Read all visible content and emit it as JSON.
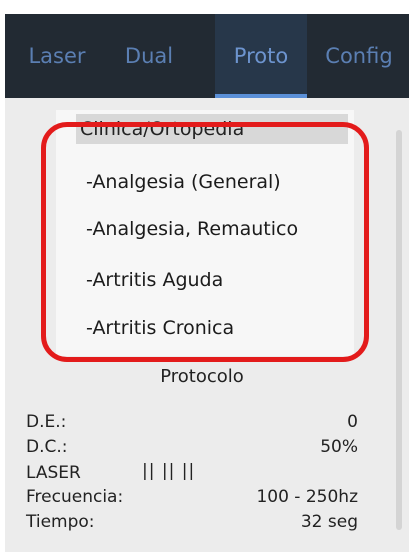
{
  "tabs": [
    {
      "label": "Laser",
      "active": false
    },
    {
      "label": "Dual",
      "active": false
    },
    {
      "label": "Proto",
      "active": true
    },
    {
      "label": "Config",
      "active": false
    }
  ],
  "protocol_list": {
    "header": "Clinica/Ortopedia",
    "items": [
      "-Analgesia (General)",
      "-Analgesia, Remautico",
      "-Artritis Aguda",
      "-Artritis Cronica"
    ]
  },
  "protocol_info": {
    "title": "Protocolo",
    "de": {
      "label": "D.E.:",
      "value": "0"
    },
    "dc": {
      "label": "D.C.:",
      "value": "50%"
    },
    "laser": {
      "label": "LASER",
      "bars": "||  ||  ||"
    },
    "frecuencia": {
      "label": "Frecuencia:",
      "value": "100 - 250hz"
    },
    "tiempo": {
      "label": "Tiempo:",
      "value": "32 seg"
    }
  },
  "colors": {
    "tabbar_bg": "#222a33",
    "tab_text": "#5b7fb3",
    "active_underline": "#5b90d8",
    "highlight": "#e31b1b"
  }
}
